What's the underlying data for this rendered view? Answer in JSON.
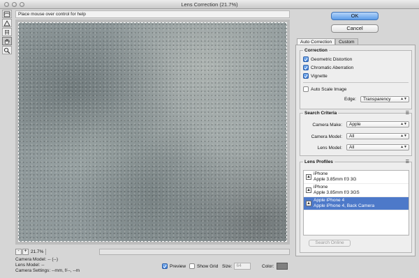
{
  "window": {
    "title": "Lens Correction (21.7%)"
  },
  "help_text": "Place mouse over control for help",
  "toolbar_icons": [
    "remove-distortion-icon",
    "straighten-icon",
    "move-grid-icon",
    "hand-icon",
    "zoom-icon"
  ],
  "zoom": {
    "minus": "-",
    "plus": "+",
    "value": "21.7%"
  },
  "camera_info": {
    "model": "Camera Model: -- (--)",
    "lens": "Lens Model: --",
    "settings": "Camera Settings: --mm, f/--, --m"
  },
  "bottom_options": {
    "preview_label": "Preview",
    "preview_checked": true,
    "show_grid_label": "Show Grid",
    "show_grid_checked": false,
    "size_label": "Size:",
    "size_value": "64",
    "color_label": "Color:",
    "color_value": "#808080"
  },
  "buttons": {
    "ok": "OK",
    "cancel": "Cancel"
  },
  "tabs": [
    "Auto Correction",
    "Custom"
  ],
  "correction": {
    "legend": "Correction",
    "geometric_distortion": "Geometric Distortion",
    "chromatic_aberration": "Chromatic Aberration",
    "vignette": "Vignette",
    "auto_scale": "Auto Scale Image",
    "edge_label": "Edge:",
    "edge_value": "Transparency"
  },
  "search_criteria": {
    "legend": "Search Criteria",
    "camera_make_label": "Camera Make:",
    "camera_make_value": "Apple",
    "camera_model_label": "Camera Model:",
    "camera_model_value": "All",
    "lens_model_label": "Lens Model:",
    "lens_model_value": "All"
  },
  "lens_profiles": {
    "legend": "Lens Profiles",
    "items": [
      {
        "line1": "iPhone",
        "line2": "Apple 3.85mm f/3 3G"
      },
      {
        "line1": "iPhone",
        "line2": "Apple 3.85mm f/3 3GS"
      },
      {
        "line1": "Apple iPhone 4",
        "line2": "Apple iPhone 4, Back Camera"
      }
    ],
    "search_online": "Search Online"
  }
}
